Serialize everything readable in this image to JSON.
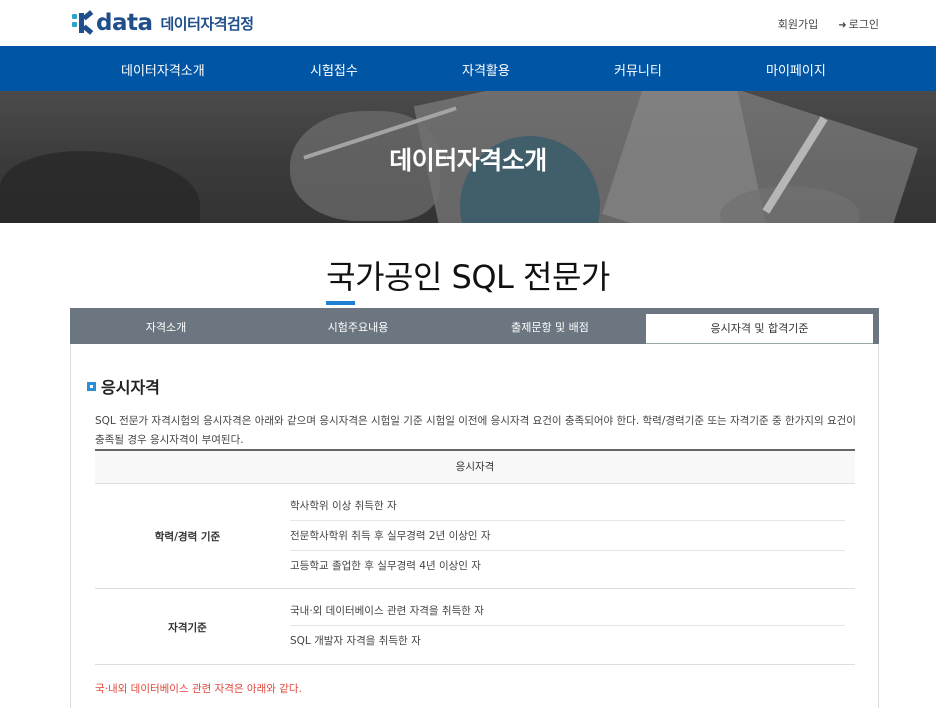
{
  "header": {
    "logo_text": "data",
    "logo_sub": "데이터자격검정",
    "signup": "회원가입",
    "login": "로그인"
  },
  "nav": {
    "items": [
      "데이터자격소개",
      "시험접수",
      "자격활용",
      "커뮤니티",
      "마이페이지"
    ]
  },
  "hero": {
    "title": "데이터자격소개"
  },
  "page": {
    "title_first": "국",
    "title_rest": "가공인 SQL 전문가"
  },
  "tabs": [
    "자격소개",
    "시험주요내용",
    "출제문항 및 배점",
    "응시자격 및 합격기준"
  ],
  "section": {
    "title": "응시자격",
    "description": "SQL 전문가 자격시험의 응시자격은 아래와 같으며 응시자격은 시험일 기준 시험일 이전에 응시자격 요건이 충족되어야 한다. 학력/경력기준 또는 자격기준 중 한가지의 요건이 충족될 경우 응시자격이 부여된다.",
    "table_header": "응시자격",
    "groups": [
      {
        "label": "학력/경력 기준",
        "items": [
          "학사학위 이상 취득한 자",
          "전문학사학위 취득 후 실무경력 2년 이상인 자",
          "고등학교 졸업한 후 실무경력 4년 이상인 자"
        ]
      },
      {
        "label": "자격기준",
        "items": [
          "국내·외 데이터베이스 관련 자격을 취득한 자",
          "SQL 개발자 자격을 취득한 자"
        ]
      }
    ],
    "note": "국·내외 데이터베이스 관련 자격은 아래와 같다."
  }
}
